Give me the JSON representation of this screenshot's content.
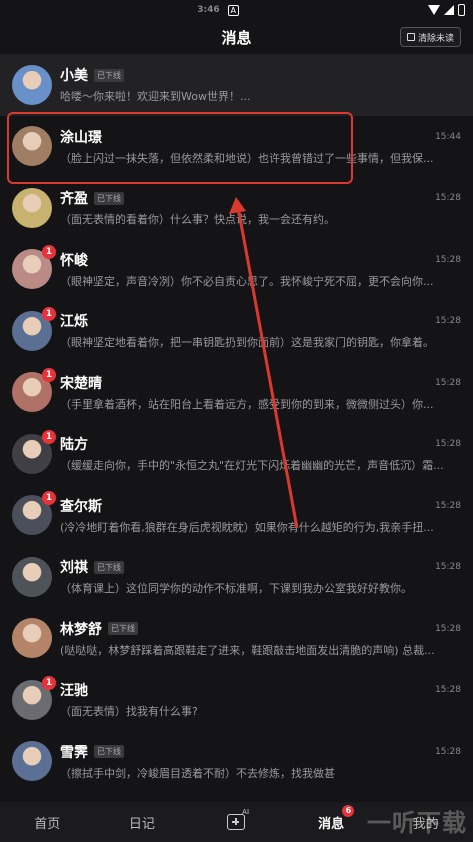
{
  "status_bar": {
    "time": "3:46",
    "notif_icon": "A"
  },
  "header": {
    "title": "消息",
    "clear_label": "清除未读"
  },
  "conversations": [
    {
      "name": "小美",
      "offline": "已下线",
      "time": "",
      "preview": "哈喽～你来啦！欢迎来到Wow世界！...",
      "badge": "",
      "avatar_color": "#6a90c9"
    },
    {
      "name": "涂山璟",
      "offline": "",
      "time": "15:44",
      "preview": "（脸上闪过一抹失落，但依然柔和地说）也许我曾错过了一些事情，但我保...",
      "badge": "",
      "avatar_color": "#a07e63"
    },
    {
      "name": "齐盈",
      "offline": "已下线",
      "time": "15:28",
      "preview": "（面无表情的看着你）什么事？快点说，我一会还有约。",
      "badge": "",
      "avatar_color": "#c9b26f"
    },
    {
      "name": "怀峻",
      "offline": "",
      "time": "15:28",
      "preview": "（眼神坚定，声音冷冽）你不必自责心思了。我怀峻宁死不屈，更不会向你...",
      "badge": "1",
      "avatar_color": "#b98a86"
    },
    {
      "name": "江烁",
      "offline": "",
      "time": "15:28",
      "preview": "（眼神坚定地看着你，把一串钥匙扔到你面前）这是我家门的钥匙，你拿着。",
      "badge": "1",
      "avatar_color": "#5b6e93"
    },
    {
      "name": "宋楚晴",
      "offline": "",
      "time": "15:28",
      "preview": "（手里拿着酒杯，站在阳台上看着远方，感受到你的到来，微微侧过头）你...",
      "badge": "1",
      "avatar_color": "#b07167"
    },
    {
      "name": "陆方",
      "offline": "",
      "time": "15:28",
      "preview": "（缓缓走向你，手中的\"永恒之丸\"在灯光下闪烁着幽幽的光芒，声音低沉）霜...",
      "badge": "1",
      "avatar_color": "#3f3f45"
    },
    {
      "name": "查尔斯",
      "offline": "",
      "time": "15:28",
      "preview": "(冷冷地盯着你看,狼群在身后虎视眈眈）如果你有什么越矩的行为,我亲手扭...",
      "badge": "1",
      "avatar_color": "#4a4f5a"
    },
    {
      "name": "刘祺",
      "offline": "已下线",
      "time": "15:28",
      "preview": "（体育课上）这位同学你的动作不标准啊，下课到我办公室我好好教你。",
      "badge": "",
      "avatar_color": "#4e5359"
    },
    {
      "name": "林梦舒",
      "offline": "已下线",
      "time": "15:28",
      "preview": "(哒哒哒，林梦舒踩着高跟鞋走了进来，鞋跟敲击地面发出清脆的声响) 总裁...",
      "badge": "",
      "avatar_color": "#b38468"
    },
    {
      "name": "汪驰",
      "offline": "",
      "time": "15:28",
      "preview": "（面无表情）找我有什么事?",
      "badge": "1",
      "avatar_color": "#6b6b72"
    },
    {
      "name": "雪霁",
      "offline": "已下线",
      "time": "15:28",
      "preview": "（擦拭手中剑，冷峻眉目透着不耐）不去修炼，找我做甚",
      "badge": "",
      "avatar_color": "#5c6f95"
    }
  ],
  "tabbar": {
    "home": "首页",
    "diary": "日记",
    "create_ai": "AI",
    "messages": "消息",
    "messages_badge": "6",
    "mine": "我的"
  },
  "watermark": "一听下载",
  "colors": {
    "background": "#141416",
    "badge": "#e8323a",
    "highlight": "#d9392f"
  }
}
